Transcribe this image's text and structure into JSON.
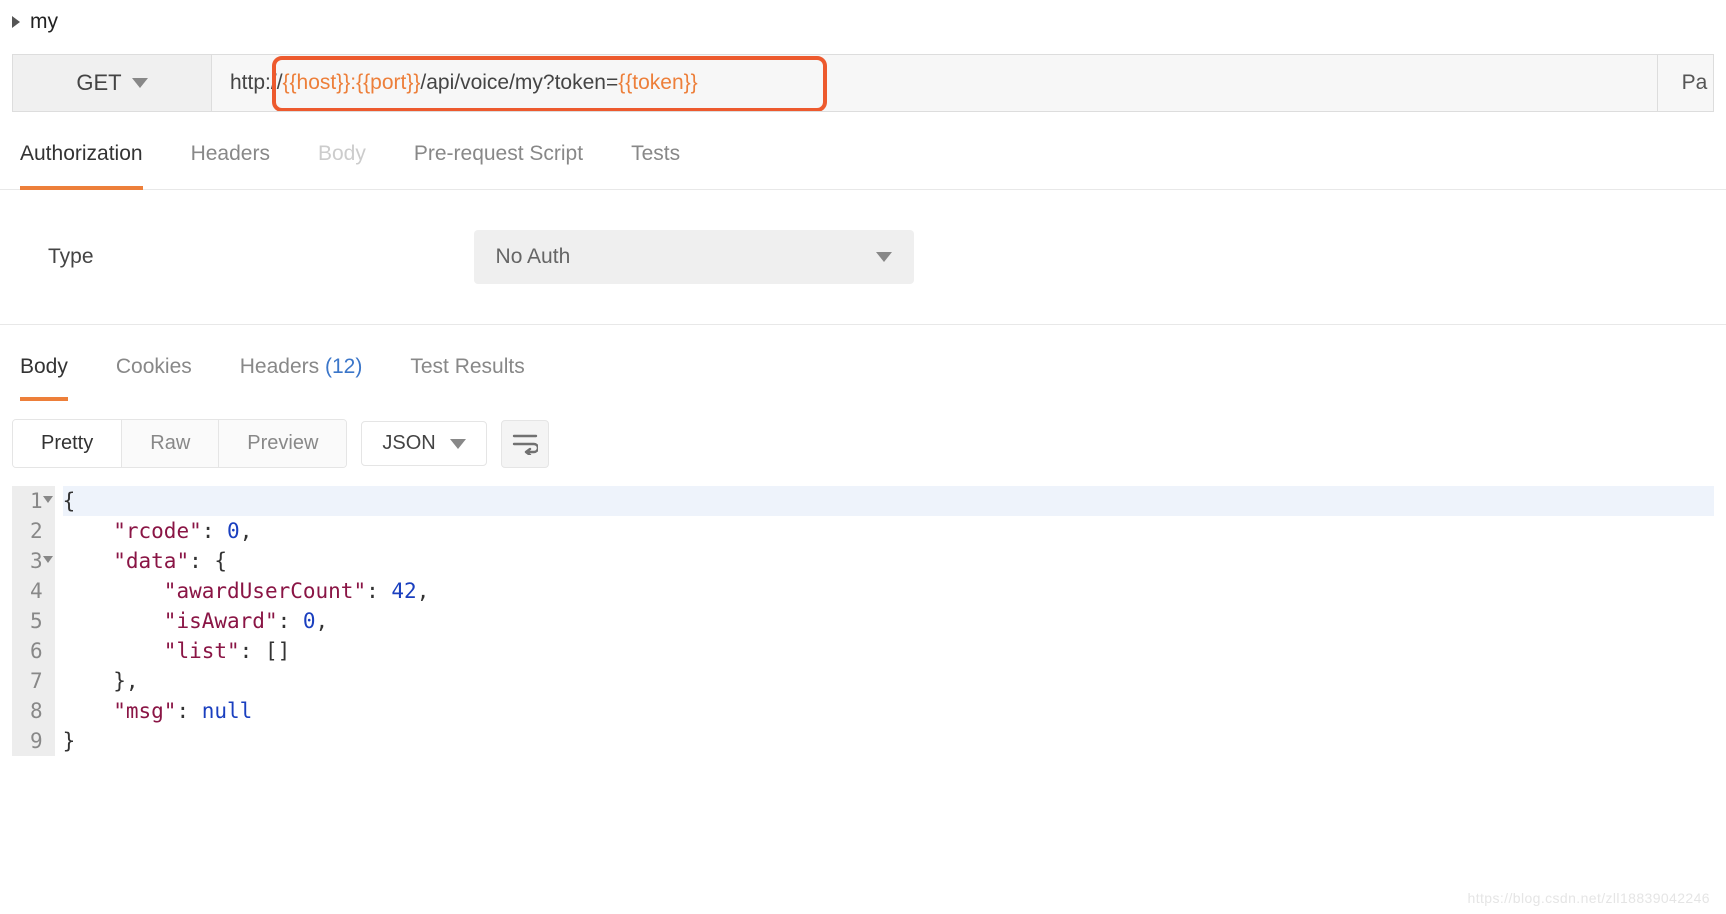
{
  "header": {
    "name": "my"
  },
  "request": {
    "method": "GET",
    "url_prefix": "http://",
    "var_host": "{{host}}",
    "sep1": ":",
    "var_port": "{{port}}",
    "path": "/api/voice/my?token=",
    "var_token": "{{token}}",
    "params_label": "Pa"
  },
  "tabs": {
    "authorization": "Authorization",
    "headers": "Headers",
    "body": "Body",
    "prescript": "Pre-request Script",
    "tests": "Tests"
  },
  "auth": {
    "type_label": "Type",
    "selected": "No Auth"
  },
  "respTabs": {
    "body": "Body",
    "cookies": "Cookies",
    "headers": "Headers",
    "headers_count": "(12)",
    "tests": "Test Results"
  },
  "format": {
    "pretty": "Pretty",
    "raw": "Raw",
    "preview": "Preview",
    "json": "JSON"
  },
  "code": {
    "l1": "{",
    "l2a": "    \"rcode\"",
    "l2b": ": ",
    "l2c": "0",
    "l2d": ",",
    "l3a": "    \"data\"",
    "l3b": ": {",
    "l4a": "        \"awardUserCount\"",
    "l4b": ": ",
    "l4c": "42",
    "l4d": ",",
    "l5a": "        \"isAward\"",
    "l5b": ": ",
    "l5c": "0",
    "l5d": ",",
    "l6a": "        \"list\"",
    "l6b": ": []",
    "l7": "    },",
    "l8a": "    \"msg\"",
    "l8b": ": ",
    "l8c": "null",
    "l9": "}"
  },
  "watermark": "https://blog.csdn.net/zll18839042246"
}
